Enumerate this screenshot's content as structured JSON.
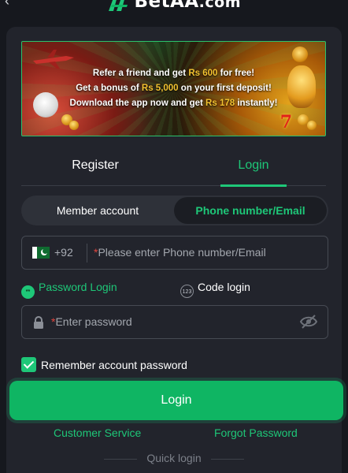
{
  "header": {
    "back_icon": "chevron-left-icon",
    "brand_main": "BetAA",
    "brand_domain": ".com",
    "logo_icon": "betaa-logo-icon"
  },
  "banner": {
    "line1_pre": "Refer a friend and get ",
    "line1_amount": "Rs 600",
    "line1_post": " for free!",
    "line2_pre": "Get a bonus of ",
    "line2_amount": "Rs 5,000",
    "line2_post": " on your first deposit!",
    "line3_pre": "Download the app now and get ",
    "line3_amount": "Rs 178",
    "line3_post": " instantly!",
    "seven": "7",
    "accent_color": "#f2c230",
    "border_color": "#2bc26c"
  },
  "tabs": {
    "register": "Register",
    "login": "Login",
    "active": "login"
  },
  "account_type": {
    "member": "Member account",
    "phone_email": "Phone number/Email",
    "selected": "phone_email"
  },
  "phone_field": {
    "country_flag_icon": "pakistan-flag-icon",
    "country_code": "+92",
    "required_mark": "*",
    "placeholder": "Please enter Phone number/Email",
    "value": ""
  },
  "login_modes": {
    "password_login": "Password Login",
    "password_icon": "password-dots-icon",
    "password_icon_text": "**",
    "code_login": "Code login",
    "code_icon": "code-123-icon",
    "code_icon_text": "123",
    "active": "password"
  },
  "password_field": {
    "lock_icon": "lock-icon",
    "required_mark": "*",
    "placeholder": "Enter password",
    "value": "",
    "visibility_icon": "eye-off-icon"
  },
  "remember": {
    "label": "Remember account password",
    "checked": true
  },
  "actions": {
    "login_button": "Login",
    "customer_service": "Customer Service",
    "forgot_password": "Forgot Password",
    "quick_login": "Quick login"
  },
  "colors": {
    "accent": "#1ec778",
    "button": "#0fb563",
    "background": "#16181e",
    "panel": "#22242c",
    "required": "#e0453d"
  }
}
